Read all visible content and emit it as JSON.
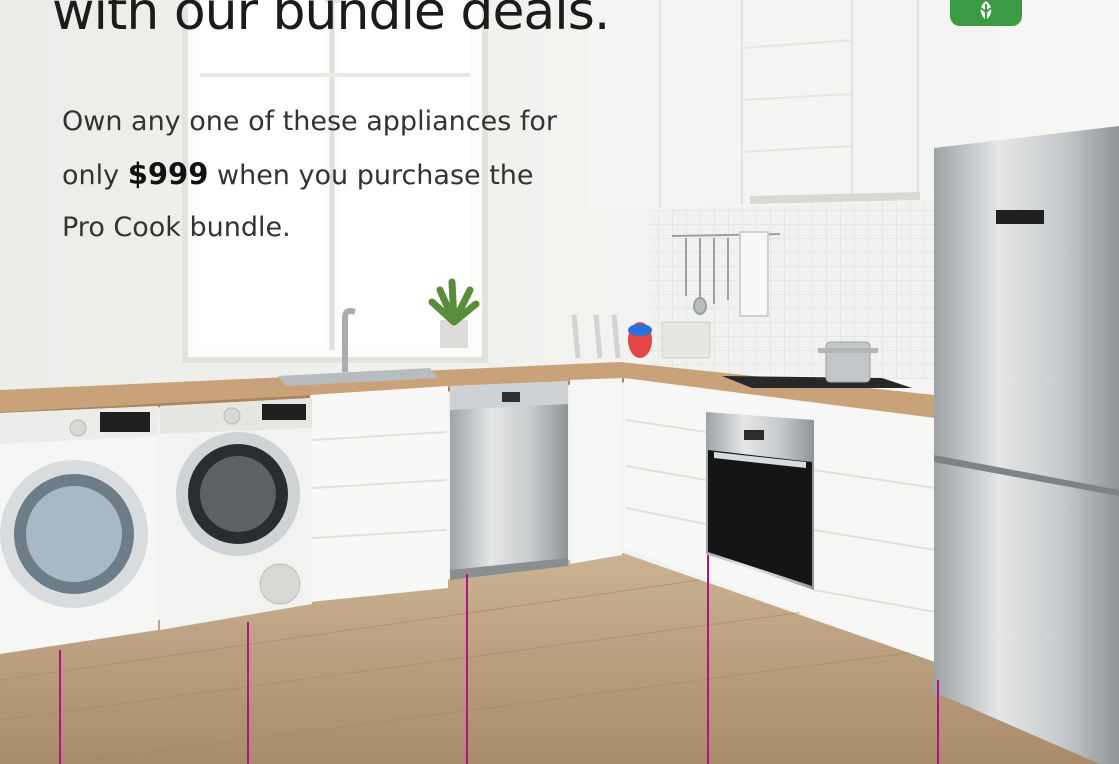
{
  "headline": "with our bundle deals.",
  "body": {
    "line1": "Own any one of these appliances for",
    "line2_before": "only ",
    "price": "$999",
    "line2_after": " when you purchase the",
    "line3": "Pro Cook bundle."
  },
  "badge": {
    "icon": "leaf-badge-icon",
    "color": "#3d9a44"
  },
  "colors": {
    "accent_line": "#b0157f",
    "wood_floor": "#b59a7a",
    "countertop": "#c9a27a"
  },
  "appliances": [
    "washing-machine",
    "dryer",
    "dishwasher",
    "oven",
    "fridge-freezer"
  ]
}
